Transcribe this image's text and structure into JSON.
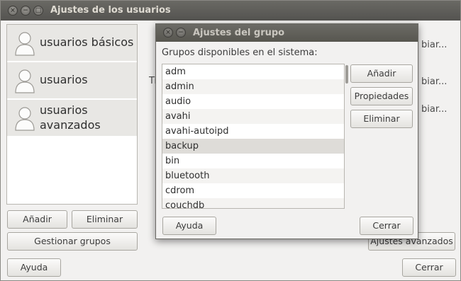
{
  "main_window": {
    "title": "Ajustes de los usuarios",
    "users": [
      {
        "name_line1": "usuarios básicos",
        "name_line2": ""
      },
      {
        "name_line1": "usuarios",
        "name_line2": ""
      },
      {
        "name_line1": "usuarios",
        "name_line2": "avanzados"
      }
    ],
    "partial_texts": {
      "t_fragment": "Ti",
      "right_1": "biar...",
      "right_2": "biar...",
      "right_3": "biar..."
    },
    "buttons": {
      "add": "Añadir",
      "remove": "Eliminar",
      "manage_groups": "Gestionar grupos",
      "advanced": "Ajustes avanzados",
      "help": "Ayuda",
      "close": "Cerrar"
    }
  },
  "group_dialog": {
    "title": "Ajustes del grupo",
    "label": "Grupos disponibles en el sistema:",
    "groups": [
      "adm",
      "admin",
      "audio",
      "avahi",
      "avahi-autoipd",
      "backup",
      "bin",
      "bluetooth",
      "cdrom",
      "couchdb"
    ],
    "selected_index": 5,
    "buttons": {
      "add": "Añadir",
      "properties": "Propiedades",
      "remove": "Eliminar",
      "help": "Ayuda",
      "close": "Cerrar"
    }
  }
}
